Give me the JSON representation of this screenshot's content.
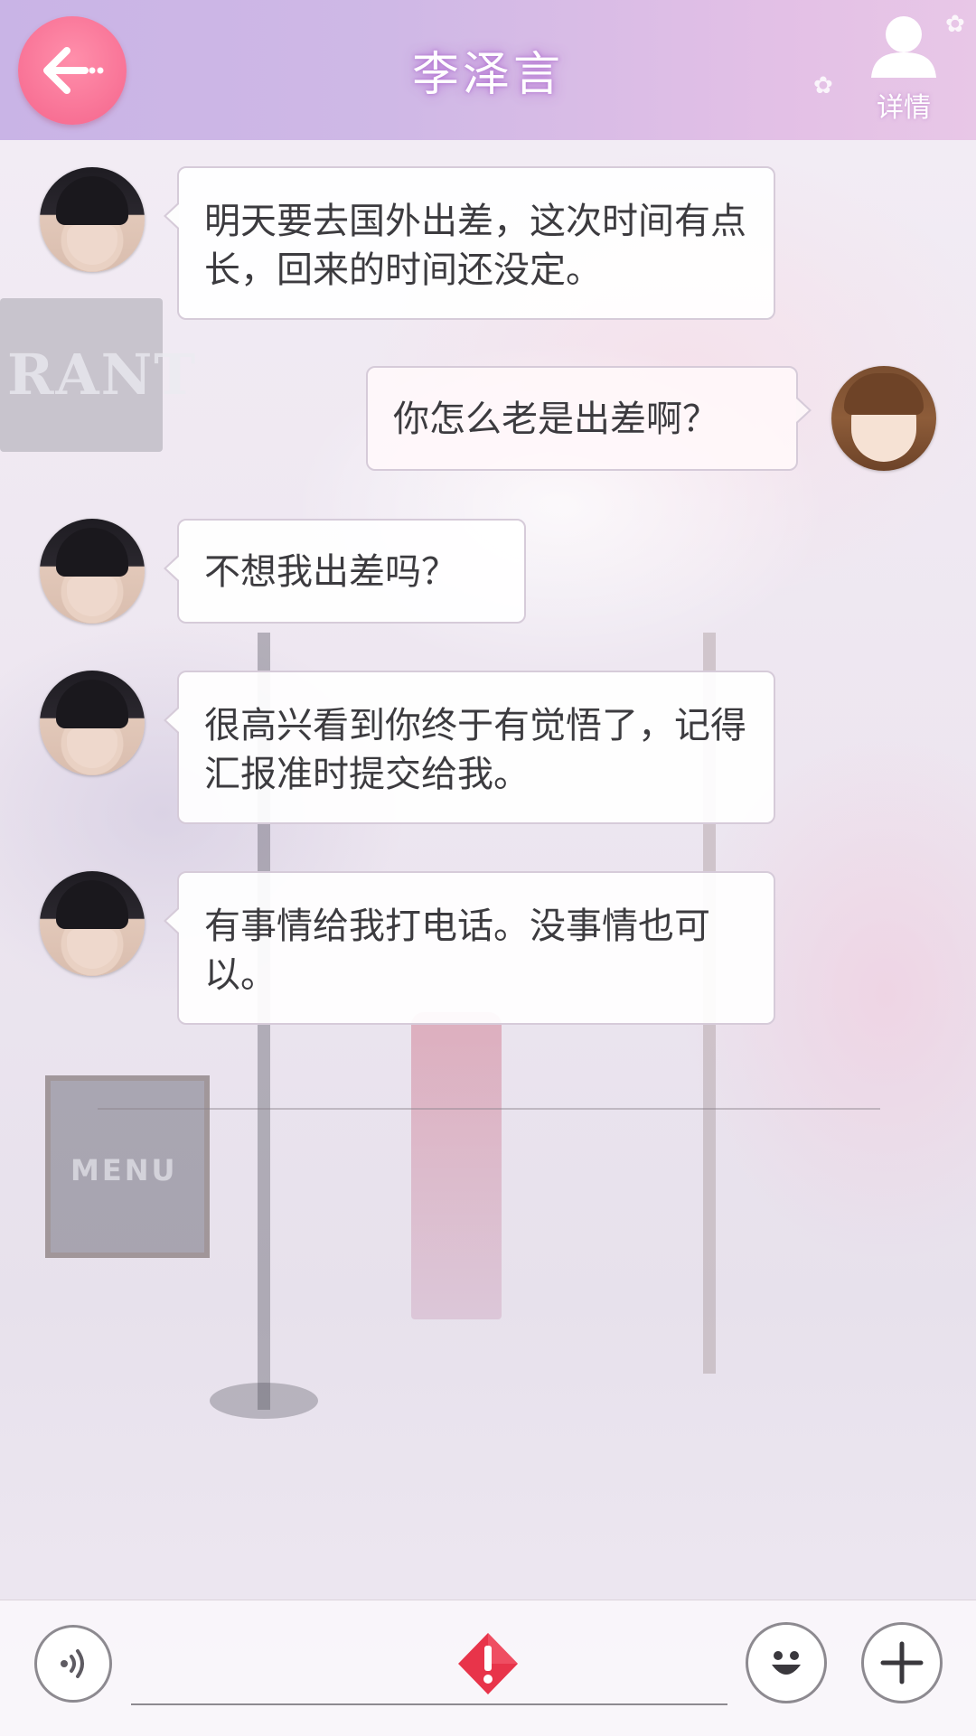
{
  "header": {
    "title": "李泽言",
    "back_icon": "arrow-left-icon",
    "details_label": "详情",
    "details_icon": "person-icon"
  },
  "background": {
    "shop_sign_text": "RANT",
    "menu_board_text": "MENU"
  },
  "messages": [
    {
      "sender": "李泽言",
      "side": "left",
      "avatar": "male-avatar",
      "text": "明天要去国外出差，这次时间有点长，回来的时间还没定。"
    },
    {
      "sender": "me",
      "side": "right",
      "avatar": "female-avatar",
      "text": "你怎么老是出差啊？"
    },
    {
      "sender": "李泽言",
      "side": "left",
      "avatar": "male-avatar",
      "text": "不想我出差吗？"
    },
    {
      "sender": "李泽言",
      "side": "left",
      "avatar": "male-avatar",
      "text": "很高兴看到你终于有觉悟了，记得汇报准时提交给我。"
    },
    {
      "sender": "李泽言",
      "side": "left",
      "avatar": "male-avatar",
      "text": "有事情给我打电话。没事情也可以。"
    }
  ],
  "toolbar": {
    "voice_icon": "voice-icon",
    "warning_icon": "warning-icon",
    "emoji_icon": "emoji-icon",
    "add_icon": "plus-icon"
  },
  "colors": {
    "back_button": "#f5658c",
    "header_gradient_start": "#c9b4e6",
    "header_gradient_end": "#e8c7e7",
    "warning": "#e8344a"
  }
}
